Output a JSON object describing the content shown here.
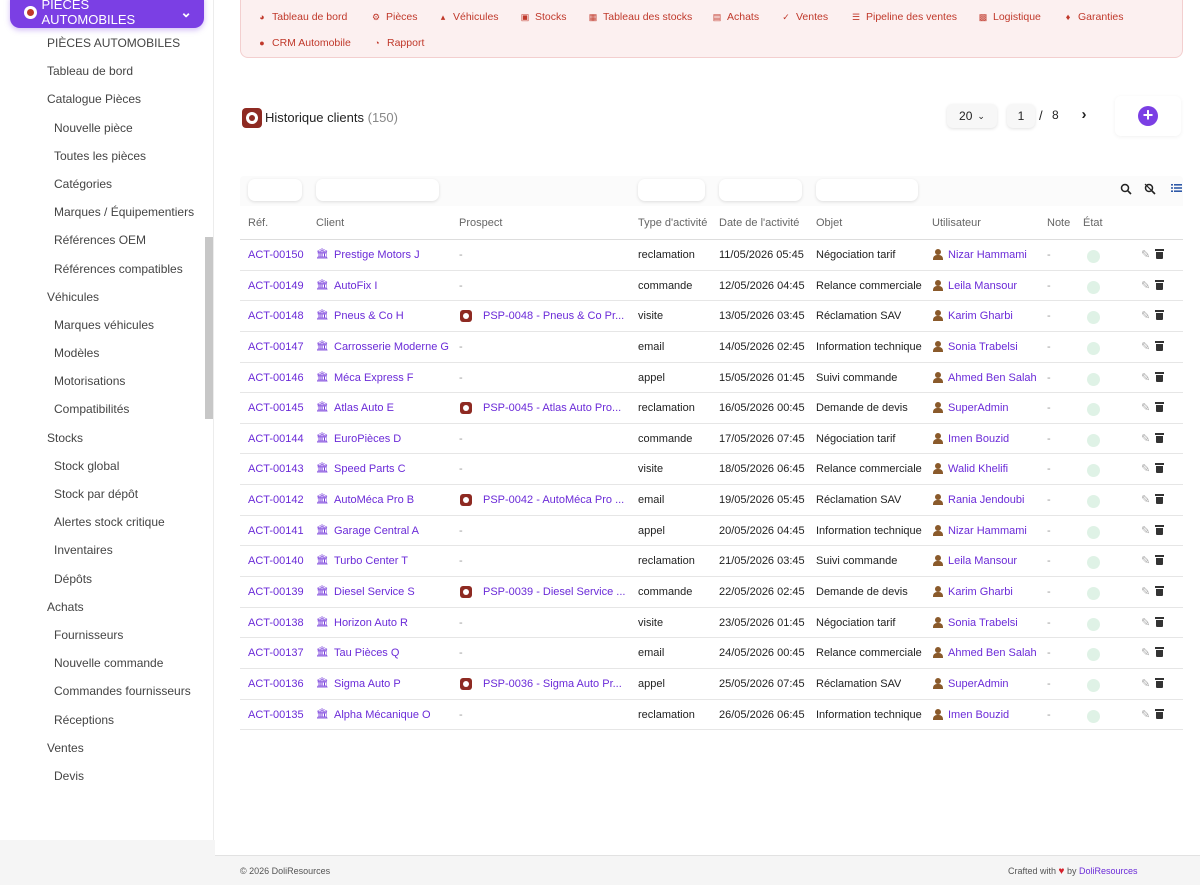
{
  "sidebar": {
    "module_label": "PIÈCES AUTOMOBILES",
    "items": [
      {
        "label": "PIÈCES AUTOMOBILES",
        "level": 1
      },
      {
        "label": "Tableau de bord",
        "level": 1
      },
      {
        "label": "Catalogue Pièces",
        "level": 1
      },
      {
        "label": "Nouvelle pièce",
        "level": 2
      },
      {
        "label": "Toutes les pièces",
        "level": 2
      },
      {
        "label": "Catégories",
        "level": 2
      },
      {
        "label": "Marques / Équipementiers",
        "level": 2
      },
      {
        "label": "Références OEM",
        "level": 2
      },
      {
        "label": "Références compatibles",
        "level": 2
      },
      {
        "label": "Véhicules",
        "level": 1
      },
      {
        "label": "Marques véhicules",
        "level": 2
      },
      {
        "label": "Modèles",
        "level": 2
      },
      {
        "label": "Motorisations",
        "level": 2
      },
      {
        "label": "Compatibilités",
        "level": 2
      },
      {
        "label": "Stocks",
        "level": 1
      },
      {
        "label": "Stock global",
        "level": 2
      },
      {
        "label": "Stock par dépôt",
        "level": 2
      },
      {
        "label": "Alertes stock critique",
        "level": 2
      },
      {
        "label": "Inventaires",
        "level": 2
      },
      {
        "label": "Dépôts",
        "level": 2
      },
      {
        "label": "Achats",
        "level": 1
      },
      {
        "label": "Fournisseurs",
        "level": 2
      },
      {
        "label": "Nouvelle commande",
        "level": 2
      },
      {
        "label": "Commandes fournisseurs",
        "level": 2
      },
      {
        "label": "Réceptions",
        "level": 2
      },
      {
        "label": "Ventes",
        "level": 1
      },
      {
        "label": "Devis",
        "level": 2
      }
    ]
  },
  "topnav": {
    "items": [
      {
        "label": "Tableau de bord",
        "icon": "gauge-icon"
      },
      {
        "label": "Pièces",
        "icon": "gear-icon"
      },
      {
        "label": "Véhicules",
        "icon": "car-icon"
      },
      {
        "label": "Stocks",
        "icon": "boxes-icon"
      },
      {
        "label": "Tableau des stocks",
        "icon": "table-icon"
      },
      {
        "label": "Achats",
        "icon": "document-icon"
      },
      {
        "label": "Ventes",
        "icon": "cart-icon"
      },
      {
        "label": "Pipeline des ventes",
        "icon": "list-icon"
      },
      {
        "label": "Logistique",
        "icon": "truck-icon"
      },
      {
        "label": "Garanties",
        "icon": "shield-icon"
      },
      {
        "label": "CRM Automobile",
        "icon": "user-plus-icon"
      },
      {
        "label": "Rapport",
        "icon": "pie-chart-icon"
      }
    ]
  },
  "page": {
    "title": "Historique clients",
    "count": "(150)"
  },
  "pager": {
    "per_page": "20",
    "current_page": "1",
    "separator": "/",
    "total_pages": "8"
  },
  "table": {
    "headers": {
      "ref": "Réf.",
      "client": "Client",
      "prospect": "Prospect",
      "type": "Type d'activité",
      "date": "Date de l'activité",
      "objet": "Objet",
      "user": "Utilisateur",
      "note": "Note",
      "etat": "État"
    },
    "rows": [
      {
        "ref": "ACT-00150",
        "client": "Prestige Motors J",
        "prospect": "-",
        "type": "reclamation",
        "date": "11/05/2026 05:45",
        "objet": "Négociation tarif",
        "user": "Nizar Hammami",
        "note": "-"
      },
      {
        "ref": "ACT-00149",
        "client": "AutoFix I",
        "prospect": "-",
        "type": "commande",
        "date": "12/05/2026 04:45",
        "objet": "Relance commerciale",
        "user": "Leila Mansour",
        "note": "-"
      },
      {
        "ref": "ACT-00148",
        "client": "Pneus & Co H",
        "prospect": "PSP-0048 - Pneus & Co Pr...",
        "type": "visite",
        "date": "13/05/2026 03:45",
        "objet": "Réclamation SAV",
        "user": "Karim Gharbi",
        "note": "-"
      },
      {
        "ref": "ACT-00147",
        "client": "Carrosserie Moderne G",
        "prospect": "-",
        "type": "email",
        "date": "14/05/2026 02:45",
        "objet": "Information technique",
        "user": "Sonia Trabelsi",
        "note": "-"
      },
      {
        "ref": "ACT-00146",
        "client": "Méca Express F",
        "prospect": "-",
        "type": "appel",
        "date": "15/05/2026 01:45",
        "objet": "Suivi commande",
        "user": "Ahmed Ben Salah",
        "note": "-"
      },
      {
        "ref": "ACT-00145",
        "client": "Atlas Auto E",
        "prospect": "PSP-0045 - Atlas Auto Pro...",
        "type": "reclamation",
        "date": "16/05/2026 00:45",
        "objet": "Demande de devis",
        "user": "SuperAdmin",
        "note": "-"
      },
      {
        "ref": "ACT-00144",
        "client": "EuroPièces D",
        "prospect": "-",
        "type": "commande",
        "date": "17/05/2026 07:45",
        "objet": "Négociation tarif",
        "user": "Imen Bouzid",
        "note": "-"
      },
      {
        "ref": "ACT-00143",
        "client": "Speed Parts C",
        "prospect": "-",
        "type": "visite",
        "date": "18/05/2026 06:45",
        "objet": "Relance commerciale",
        "user": "Walid Khelifi",
        "note": "-"
      },
      {
        "ref": "ACT-00142",
        "client": "AutoMéca Pro B",
        "prospect": "PSP-0042 - AutoMéca Pro ...",
        "type": "email",
        "date": "19/05/2026 05:45",
        "objet": "Réclamation SAV",
        "user": "Rania Jendoubi",
        "note": "-"
      },
      {
        "ref": "ACT-00141",
        "client": "Garage Central A",
        "prospect": "-",
        "type": "appel",
        "date": "20/05/2026 04:45",
        "objet": "Information technique",
        "user": "Nizar Hammami",
        "note": "-"
      },
      {
        "ref": "ACT-00140",
        "client": "Turbo Center T",
        "prospect": "-",
        "type": "reclamation",
        "date": "21/05/2026 03:45",
        "objet": "Suivi commande",
        "user": "Leila Mansour",
        "note": "-"
      },
      {
        "ref": "ACT-00139",
        "client": "Diesel Service S",
        "prospect": "PSP-0039 - Diesel Service ...",
        "type": "commande",
        "date": "22/05/2026 02:45",
        "objet": "Demande de devis",
        "user": "Karim Gharbi",
        "note": "-"
      },
      {
        "ref": "ACT-00138",
        "client": "Horizon Auto R",
        "prospect": "-",
        "type": "visite",
        "date": "23/05/2026 01:45",
        "objet": "Négociation tarif",
        "user": "Sonia Trabelsi",
        "note": "-"
      },
      {
        "ref": "ACT-00137",
        "client": "Tau Pièces Q",
        "prospect": "-",
        "type": "email",
        "date": "24/05/2026 00:45",
        "objet": "Relance commerciale",
        "user": "Ahmed Ben Salah",
        "note": "-"
      },
      {
        "ref": "ACT-00136",
        "client": "Sigma Auto P",
        "prospect": "PSP-0036 - Sigma Auto Pr...",
        "type": "appel",
        "date": "25/05/2026 07:45",
        "objet": "Réclamation SAV",
        "user": "SuperAdmin",
        "note": "-"
      },
      {
        "ref": "ACT-00135",
        "client": "Alpha Mécanique O",
        "prospect": "-",
        "type": "reclamation",
        "date": "26/05/2026 06:45",
        "objet": "Information technique",
        "user": "Imen Bouzid",
        "note": "-"
      }
    ]
  },
  "footer": {
    "copyright": "© 2026 DoliResources",
    "crafted": "Crafted with",
    "by": "by",
    "brand": "DoliResources"
  },
  "colors": {
    "accent": "#7b3fe4",
    "nav_red": "#c0392b",
    "link": "#6b2bd8",
    "status_green": "#dff2e6"
  }
}
